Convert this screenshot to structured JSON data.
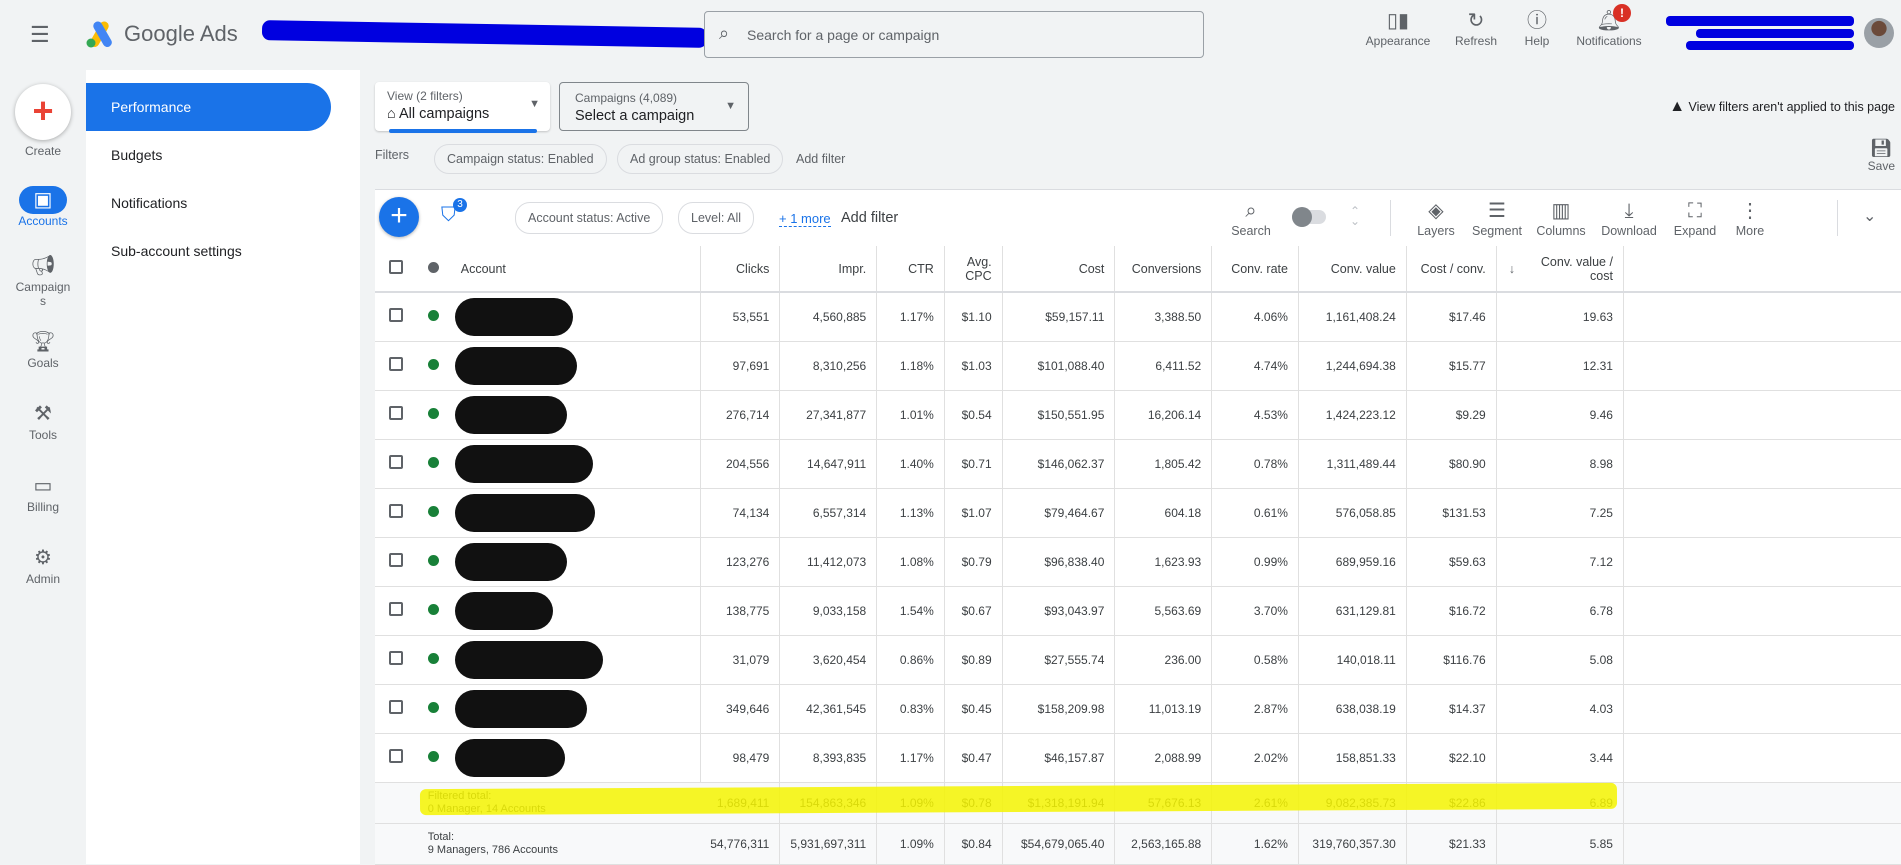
{
  "header": {
    "app_name": "Google Ads",
    "search_placeholder": "Search for a page or campaign",
    "actions": [
      {
        "label": "Appearance",
        "icon": "appearance-icon"
      },
      {
        "label": "Refresh",
        "icon": "refresh-icon"
      },
      {
        "label": "Help",
        "icon": "help-icon"
      },
      {
        "label": "Notifications",
        "icon": "bell-icon",
        "badge": "!"
      }
    ]
  },
  "rail": {
    "create": "Create",
    "items": [
      {
        "label": "Accounts",
        "icon": "accounts-icon",
        "active": true
      },
      {
        "label": "Campaigns",
        "icon": "megaphone-icon"
      },
      {
        "label": "Goals",
        "icon": "trophy-icon"
      },
      {
        "label": "Tools",
        "icon": "tools-icon"
      },
      {
        "label": "Billing",
        "icon": "credit-card-icon"
      },
      {
        "label": "Admin",
        "icon": "gear-icon"
      }
    ]
  },
  "subnav": [
    "Performance",
    "Budgets",
    "Notifications",
    "Sub-account settings"
  ],
  "view": {
    "label": "View (2 filters)",
    "value": "All campaigns"
  },
  "campaigns": {
    "label": "Campaigns (4,089)",
    "value": "Select a campaign"
  },
  "warning": "View filters aren't applied to this page",
  "save": "Save",
  "filters": {
    "label": "Filters",
    "chips": [
      "Campaign status: Enabled",
      "Ad group status: Enabled"
    ],
    "add": "Add filter"
  },
  "toolbar": {
    "filter_badge": "3",
    "chips": [
      "Account status: Active",
      "Level: All"
    ],
    "more": "+ 1 more",
    "add_filter": "Add filter",
    "tools": [
      "Search",
      "Layers",
      "Segment",
      "Columns",
      "Download",
      "Expand",
      "More"
    ]
  },
  "colors": {
    "accent": "#1a73e8",
    "status_enabled": "#188038",
    "highlight": "#f5f500"
  },
  "table": {
    "columns": [
      "Account",
      "Clicks",
      "Impr.",
      "CTR",
      "Avg. CPC",
      "Cost",
      "Conversions",
      "Conv. rate",
      "Conv. value",
      "Cost / conv.",
      "Conv. value / cost"
    ],
    "sort": "Conv. value / cost descending",
    "rows": [
      [
        "53,551",
        "4,560,885",
        "1.17%",
        "$1.10",
        "$59,157.11",
        "3,388.50",
        "4.06%",
        "1,161,408.24",
        "$17.46",
        "19.63"
      ],
      [
        "97,691",
        "8,310,256",
        "1.18%",
        "$1.03",
        "$101,088.40",
        "6,411.52",
        "4.74%",
        "1,244,694.38",
        "$15.77",
        "12.31"
      ],
      [
        "276,714",
        "27,341,877",
        "1.01%",
        "$0.54",
        "$150,551.95",
        "16,206.14",
        "4.53%",
        "1,424,223.12",
        "$9.29",
        "9.46"
      ],
      [
        "204,556",
        "14,647,911",
        "1.40%",
        "$0.71",
        "$146,062.37",
        "1,805.42",
        "0.78%",
        "1,311,489.44",
        "$80.90",
        "8.98"
      ],
      [
        "74,134",
        "6,557,314",
        "1.13%",
        "$1.07",
        "$79,464.67",
        "604.18",
        "0.61%",
        "576,058.85",
        "$131.53",
        "7.25"
      ],
      [
        "123,276",
        "11,412,073",
        "1.08%",
        "$0.79",
        "$96,838.40",
        "1,623.93",
        "0.99%",
        "689,959.16",
        "$59.63",
        "7.12"
      ],
      [
        "138,775",
        "9,033,158",
        "1.54%",
        "$0.67",
        "$93,043.97",
        "5,563.69",
        "3.70%",
        "631,129.81",
        "$16.72",
        "6.78"
      ],
      [
        "31,079",
        "3,620,454",
        "0.86%",
        "$0.89",
        "$27,555.74",
        "236.00",
        "0.58%",
        "140,018.11",
        "$116.76",
        "5.08"
      ],
      [
        "349,646",
        "42,361,545",
        "0.83%",
        "$0.45",
        "$158,209.98",
        "11,013.19",
        "2.87%",
        "638,038.19",
        "$14.37",
        "4.03"
      ],
      [
        "98,479",
        "8,393,835",
        "1.17%",
        "$0.47",
        "$46,157.87",
        "2,088.99",
        "2.02%",
        "158,851.33",
        "$22.10",
        "3.44"
      ]
    ],
    "totals": [
      {
        "label": "Filtered total:",
        "sub": "0 Manager, 14 Accounts",
        "values": [
          "1,689,411",
          "154,863,346",
          "1.09%",
          "$0.78",
          "$1,318,191.94",
          "57,676.13",
          "2.61%",
          "9,082,385.73",
          "$22.86",
          "6.89"
        ]
      },
      {
        "label": "Total:",
        "sub": "9 Managers, 786 Accounts",
        "values": [
          "54,776,311",
          "5,931,697,311",
          "1.09%",
          "$0.84",
          "$54,679,065.40",
          "2,563,165.88",
          "1.62%",
          "319,760,357.30",
          "$21.33",
          "5.85"
        ]
      }
    ]
  }
}
